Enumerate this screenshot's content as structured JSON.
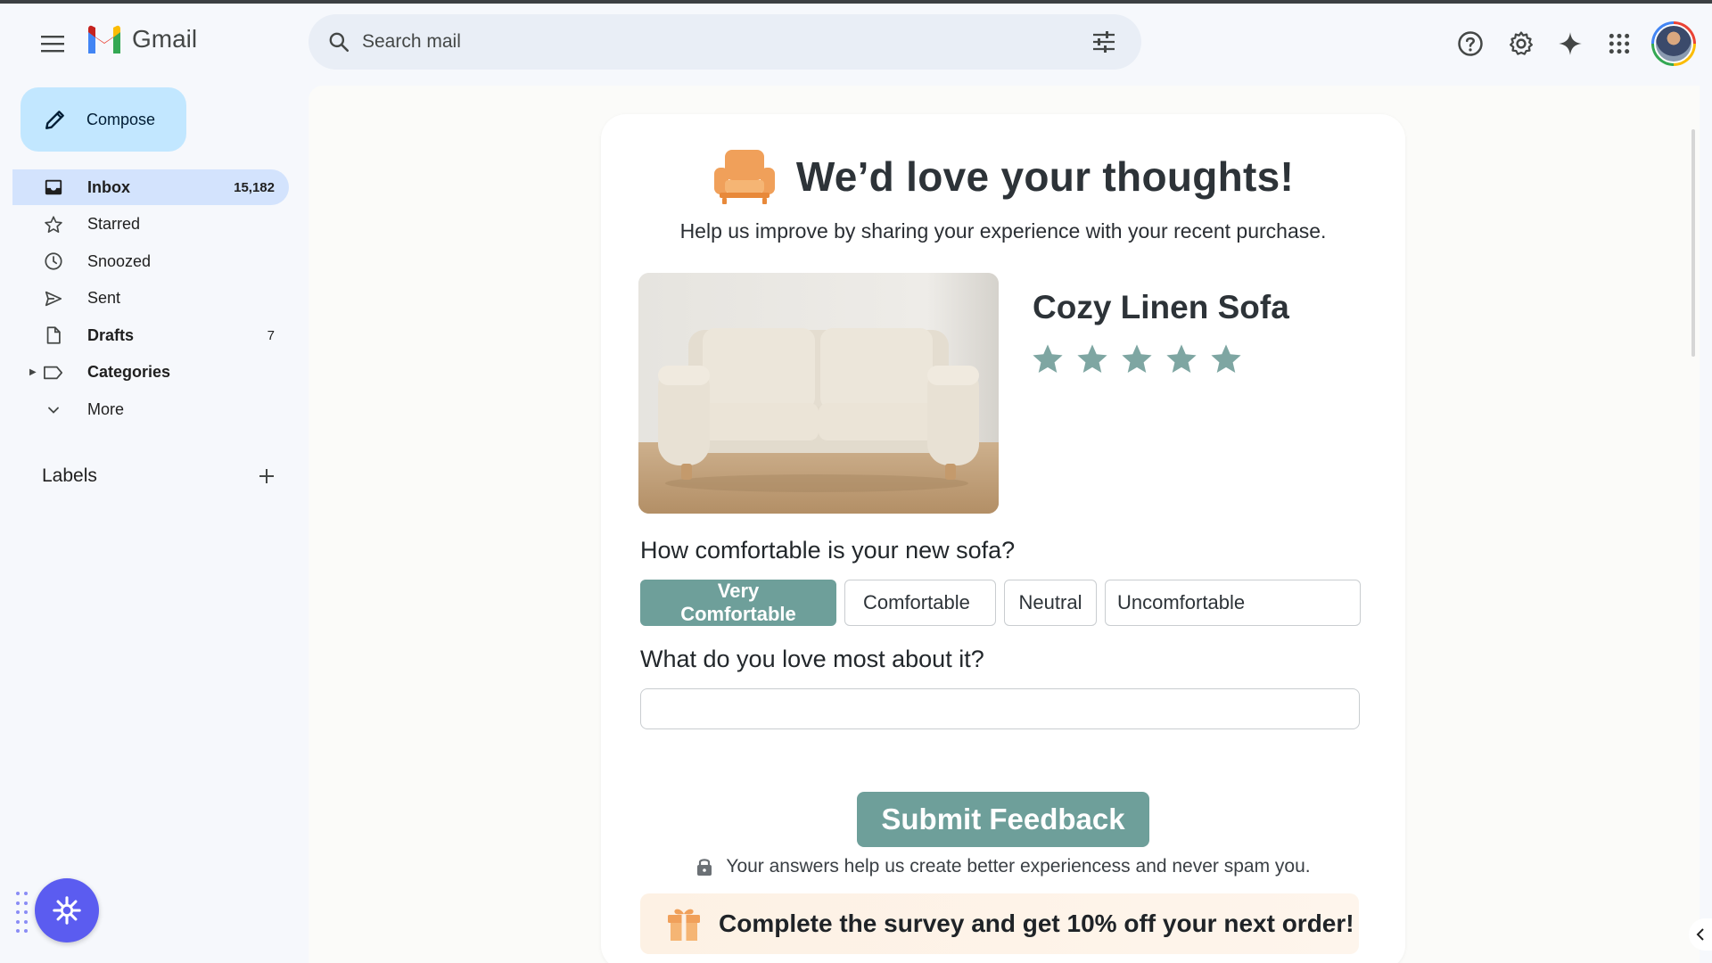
{
  "app": {
    "name": "Gmail"
  },
  "search": {
    "placeholder": "Search mail"
  },
  "sidebar": {
    "compose_label": "Compose",
    "items": [
      {
        "label": "Inbox",
        "count": "15,182",
        "icon": "inbox-icon",
        "active": true
      },
      {
        "label": "Starred",
        "count": "",
        "icon": "star-icon"
      },
      {
        "label": "Snoozed",
        "count": "",
        "icon": "clock-icon"
      },
      {
        "label": "Sent",
        "count": "",
        "icon": "send-icon"
      },
      {
        "label": "Drafts",
        "count": "7",
        "icon": "draft-icon"
      },
      {
        "label": "Categories",
        "count": "",
        "icon": "label-icon"
      },
      {
        "label": "More",
        "count": "",
        "icon": "chevron-down-icon"
      }
    ],
    "labels_title": "Labels"
  },
  "email": {
    "title": "We’d love your thoughts!",
    "subtitle": "Help us improve by sharing your experience with your recent purchase.",
    "product_name": "Cozy Linen Sofa",
    "rating": {
      "stars": 5
    },
    "question1": "How comfortable is your new sofa?",
    "options": [
      "Very Comfortable",
      "Comfortable",
      "Neutral",
      "Uncomfortable"
    ],
    "selected_option": "Very Comfortable",
    "question2": "What do you love most about it?",
    "answer_value": "",
    "submit_label": "Submit Feedback",
    "privacy_note": "Your answers help us create better experiencess and never spam you.",
    "promo_text": "Complete the survey and get 10% off your next order!"
  },
  "colors": {
    "accent": "#6e9f9a",
    "compose_bg": "#c2e7ff",
    "active_nav": "#d3e3fd",
    "chair_orange": "#f0a05a",
    "fab": "#5b5cf0"
  }
}
